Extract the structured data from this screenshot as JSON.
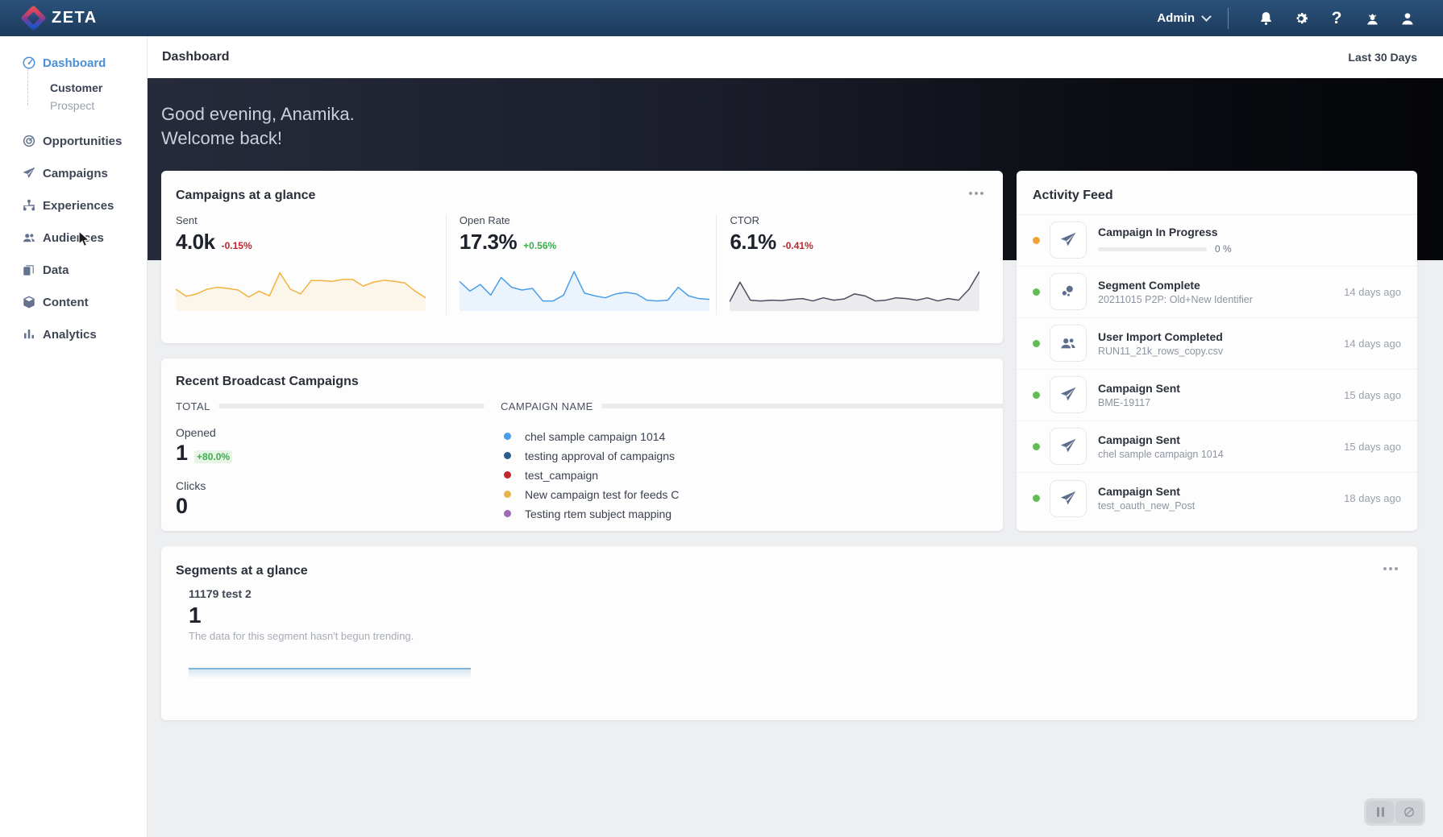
{
  "topbar": {
    "brand": "ZETA",
    "admin_label": "Admin",
    "icons": [
      "notifications-bell",
      "settings-gear",
      "help-question",
      "support-agent",
      "user-profile"
    ],
    "help_glyph": "?"
  },
  "sidebar": {
    "items": [
      {
        "label": "Dashboard",
        "icon": "gauge-icon",
        "active": true
      },
      {
        "label": "Opportunities",
        "icon": "target-icon",
        "active": false
      },
      {
        "label": "Campaigns",
        "icon": "paper-plane-icon",
        "active": false
      },
      {
        "label": "Experiences",
        "icon": "flow-icon",
        "active": false
      },
      {
        "label": "Audiences",
        "icon": "people-icon",
        "active": false
      },
      {
        "label": "Data",
        "icon": "pages-icon",
        "active": false
      },
      {
        "label": "Content",
        "icon": "cube-icon",
        "active": false
      },
      {
        "label": "Analytics",
        "icon": "bar-chart-icon",
        "active": false
      }
    ],
    "dashboard_sub_items": [
      {
        "label": "Customer",
        "selected": true
      },
      {
        "label": "Prospect",
        "selected": false
      }
    ]
  },
  "header": {
    "title": "Dashboard",
    "date_range": "Last 30 Days"
  },
  "hero": {
    "greeting_line1": "Good evening, Anamika.",
    "greeting_line2": "Welcome back!"
  },
  "campaigns_glance": {
    "title": "Campaigns at a glance",
    "stats": [
      {
        "label": "Sent",
        "value": "4.0k",
        "delta": "-0.15%",
        "delta_color": "#c0272d",
        "color": "#f2b33e",
        "points": [
          50,
          32,
          38,
          50,
          55,
          52,
          48,
          30,
          45,
          33,
          92,
          50,
          38,
          72,
          72,
          70,
          75,
          75,
          58,
          68,
          73,
          70,
          66,
          45,
          28
        ]
      },
      {
        "label": "Open Rate",
        "value": "17.3%",
        "delta": "+0.56%",
        "delta_color": "#3cae4c",
        "color": "#4a9ee8",
        "points": [
          70,
          45,
          62,
          35,
          80,
          55,
          48,
          52,
          20,
          20,
          35,
          95,
          40,
          33,
          28,
          38,
          42,
          38,
          22,
          20,
          22,
          55,
          33,
          26,
          24
        ]
      },
      {
        "label": "CTOR",
        "value": "6.1%",
        "delta": "-0.41%",
        "delta_color": "#c0272d",
        "color": "#534a63",
        "points": [
          18,
          68,
          22,
          20,
          22,
          21,
          24,
          26,
          20,
          28,
          22,
          25,
          38,
          33,
          20,
          22,
          28,
          26,
          22,
          28,
          20,
          26,
          22,
          50,
          95
        ]
      }
    ]
  },
  "activity_feed": {
    "title": "Activity Feed",
    "items": [
      {
        "title": "Campaign In Progress",
        "subtitle": "",
        "time": "",
        "status_color": "#f0a338",
        "icon": "paper-plane-icon",
        "progress_label": "0 %"
      },
      {
        "title": "Segment Complete",
        "subtitle": "20211015 P2P: Old+New Identifier",
        "time": "14 days ago",
        "status_color": "#63bb55",
        "icon": "segment-icon"
      },
      {
        "title": "User Import Completed",
        "subtitle": "RUN11_21k_rows_copy.csv",
        "time": "14 days ago",
        "status_color": "#63bb55",
        "icon": "people-icon"
      },
      {
        "title": "Campaign Sent",
        "subtitle": "BME-19117",
        "time": "15 days ago",
        "status_color": "#63bb55",
        "icon": "paper-plane-icon"
      },
      {
        "title": "Campaign Sent",
        "subtitle": "chel sample campaign 1014",
        "time": "15 days ago",
        "status_color": "#63bb55",
        "icon": "paper-plane-icon"
      },
      {
        "title": "Campaign Sent",
        "subtitle": "test_oauth_new_Post",
        "time": "18 days ago",
        "status_color": "#63bb55",
        "icon": "paper-plane-icon"
      }
    ]
  },
  "recent_broadcast": {
    "title": "Recent Broadcast Campaigns",
    "total_label": "TOTAL",
    "campaign_name_label": "CAMPAIGN NAME",
    "metrics": [
      {
        "label": "Opened",
        "value": "1",
        "delta": "+80.0%",
        "delta_color": "#3cae4c"
      },
      {
        "label": "Clicks",
        "value": "0",
        "delta": "",
        "delta_color": ""
      }
    ],
    "campaigns": [
      {
        "name": "chel sample campaign 1014",
        "color": "#4a9fe8"
      },
      {
        "name": "testing approval of campaigns",
        "color": "#2b5c8f"
      },
      {
        "name": "test_campaign",
        "color": "#c0272d"
      },
      {
        "name": "New campaign test for feeds C",
        "color": "#e8b54a"
      },
      {
        "name": "Testing rtem subject mapping",
        "color": "#9b6bb3"
      }
    ]
  },
  "segments_glance": {
    "title": "Segments at a glance",
    "segment_name": "11179 test 2",
    "value": "1",
    "note": "The data for this segment hasn't begun trending."
  },
  "footer_controls": {
    "buttons": [
      "pause",
      "disable-auto-refresh"
    ]
  },
  "colors": {
    "topbar": "#234569",
    "hero_left": "#262b3b",
    "hero_right": "#050609",
    "page_bg": "#edeff1",
    "active_nav": "#4a90d8",
    "negative": "#c0272d",
    "positive": "#3cae4c"
  }
}
